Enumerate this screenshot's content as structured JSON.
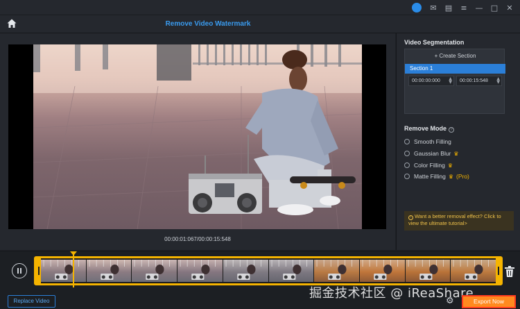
{
  "header": {
    "title": "Remove Video Watermark"
  },
  "titlebar": {
    "icons": [
      "user-avatar-icon",
      "mail-icon",
      "feedback-icon",
      "menu-icon",
      "minimize-icon",
      "maximize-icon",
      "close-icon"
    ],
    "glyphs": {
      "mail": "✉",
      "feedback": "▤",
      "menu": "≡",
      "minimize": "—",
      "maximize": "□",
      "close": "✕"
    }
  },
  "preview": {
    "timecode": "00:00:01:067/00:00:15:548"
  },
  "segmentation": {
    "title": "Video Segmentation",
    "create_label": "+ Create Section",
    "section_label": "Section 1",
    "start_time": "00:00:00:000",
    "end_time": "00:00:15:548"
  },
  "remove_mode": {
    "title": "Remove Mode",
    "options": [
      {
        "label": "Smooth Filling",
        "crown": false,
        "pro": ""
      },
      {
        "label": "Gaussian Blur",
        "crown": true,
        "pro": ""
      },
      {
        "label": "Color Filling",
        "crown": true,
        "pro": ""
      },
      {
        "label": "Matte Filling",
        "crown": true,
        "pro": "(Pro)"
      }
    ]
  },
  "tip": {
    "text": "Want a better removal effect? Click to view the ultimate tutorial>"
  },
  "timeline": {
    "replace_label": "Replace Video",
    "export_label": "Export Now",
    "watermark": "掘金技术社区 @ iReaShare",
    "playhead_progress": 0.07
  },
  "colors": {
    "accent": "#2b7fd8",
    "title": "#3a9cf0",
    "highlight": "#f5b400",
    "export": "#ff8a1f"
  }
}
